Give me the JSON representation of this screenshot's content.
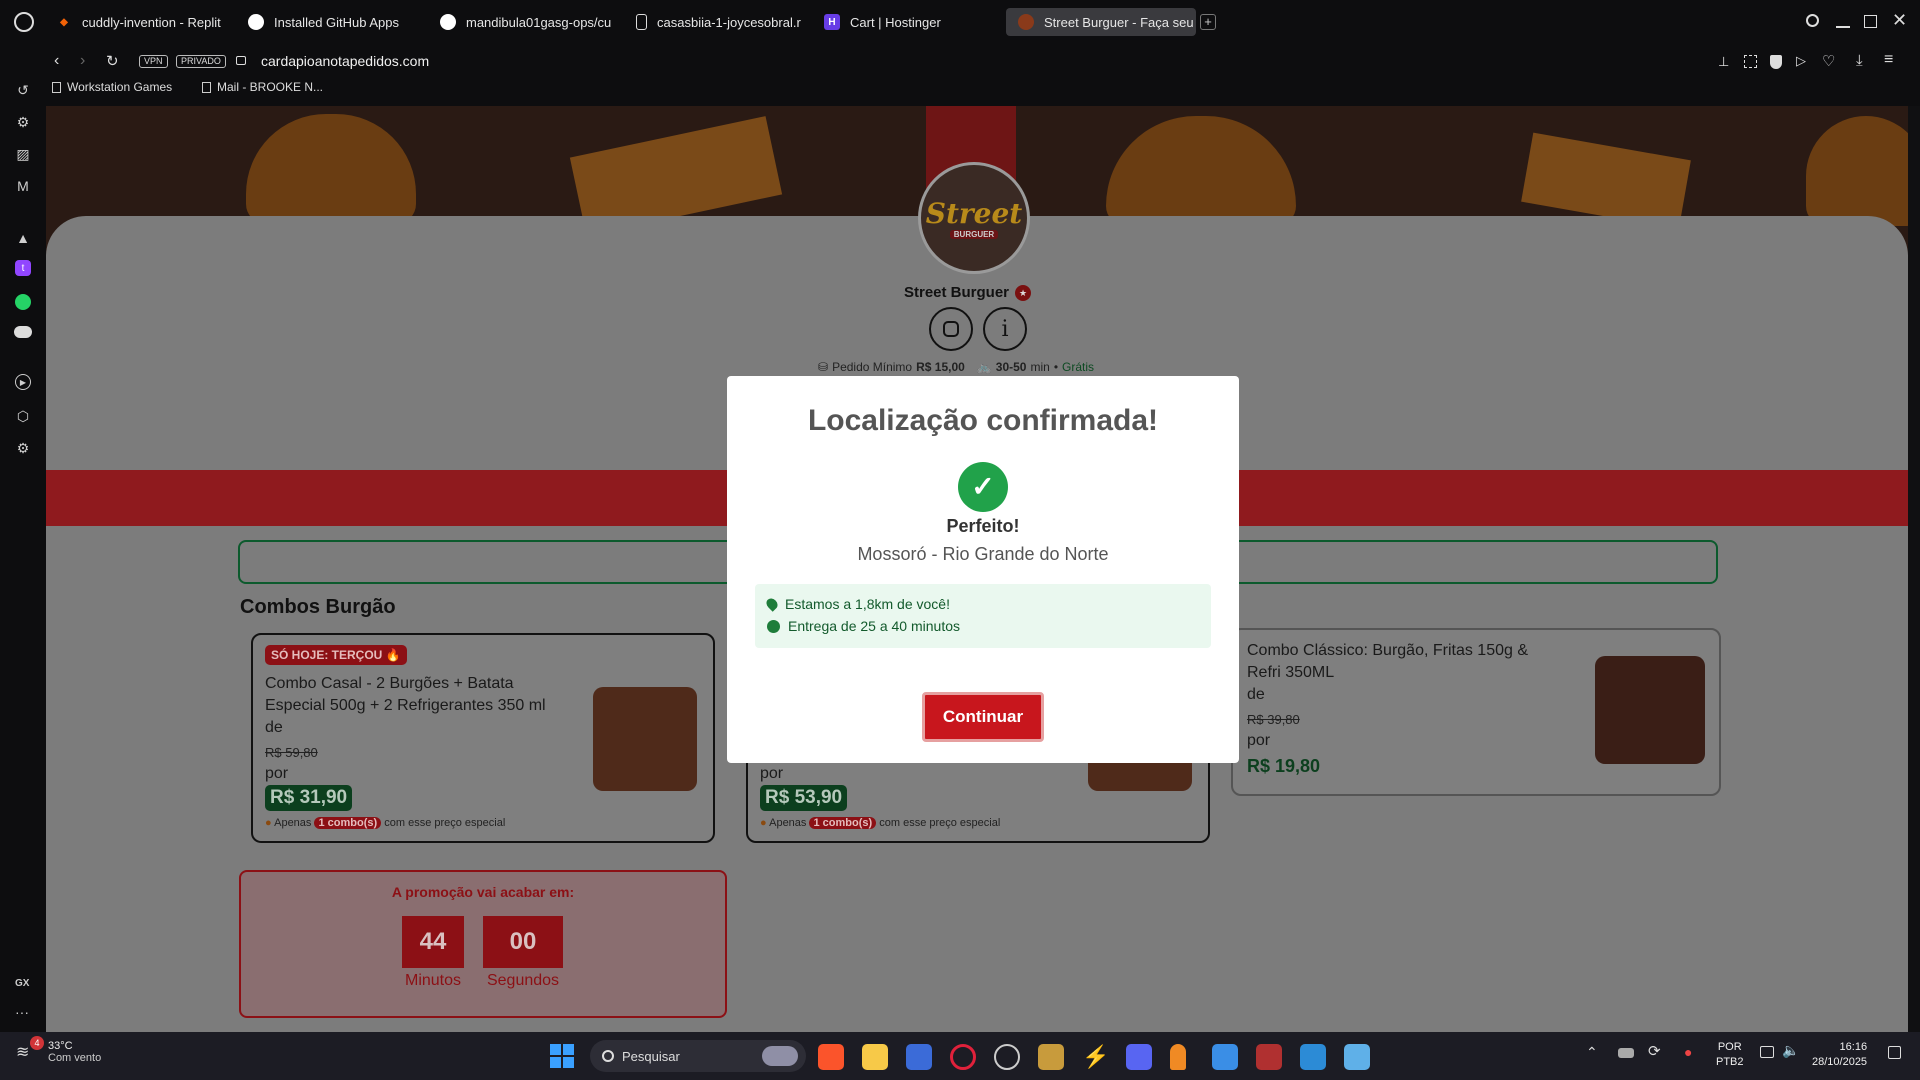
{
  "tabs": [
    {
      "label": "cuddly-invention - Replit",
      "icon": "replit-icon",
      "color": "#f26207"
    },
    {
      "label": "Installed GitHub Apps",
      "icon": "github-icon",
      "color": "#ffffff"
    },
    {
      "label": "mandibula01gasg-ops/cu",
      "icon": "github-icon",
      "color": "#ffffff"
    },
    {
      "label": "casasbiia-1-joycesobral.r",
      "icon": "file-icon",
      "color": "#dddddd"
    },
    {
      "label": "Cart | Hostinger",
      "icon": "hostinger-icon",
      "color": "#673de6"
    },
    {
      "label": "Street Burguer - Faça seu",
      "icon": "burger-icon",
      "color": "#c0392b"
    }
  ],
  "address": {
    "vpn": "VPN",
    "private": "PRIVADO",
    "url": "cardapioanotapedidos.com"
  },
  "bookmarks": [
    "Workstation Games",
    "Mail - BROOKE N..."
  ],
  "store": {
    "logo_text": "Street",
    "logo_sub": "BURGUER",
    "name": "Street Burguer",
    "min_order_label": "Pedido Mínimo",
    "min_order_value": "R$ 15,00",
    "delivery_time": "30-50",
    "time_unit": "min",
    "delivery_fee": "Grátis"
  },
  "section_title": "Combos Burgão",
  "products": [
    {
      "badge": "SÓ HOJE: TERÇOU",
      "name_line1": "Combo Casal - 2 Burgões + Batata",
      "name_line2": "Especial 500g + 2 Refrigerantes 350 ml",
      "de": "de",
      "old_price": "R$ 59,80",
      "por": "por",
      "price": "R$ 31,90",
      "note_pre": "Apenas",
      "note_count": "1 combo(s)",
      "note_post": "com esse preço especial"
    },
    {
      "por": "por",
      "price": "R$ 53,90",
      "note_pre": "Apenas",
      "note_count": "1 combo(s)",
      "note_post": "com esse preço especial"
    },
    {
      "name_line1": "Combo Clássico: Burgão, Fritas 150g &",
      "name_line2": "Refri 350ML",
      "de": "de",
      "old_price": "R$ 39,80",
      "por": "por",
      "price": "R$ 19,80"
    }
  ],
  "promo": {
    "title": "A promoção vai acabar em:",
    "minutes": "44",
    "seconds": "00",
    "minutes_label": "Minutos",
    "seconds_label": "Segundos"
  },
  "modal": {
    "title": "Localização confirmada!",
    "subtitle": "Perfeito!",
    "location": "Mossoró - Rio Grande do Norte",
    "info1": "Estamos a 1,8km de você!",
    "info2": "Entrega de 25 a 40 minutos",
    "button": "Continuar"
  },
  "taskbar": {
    "temp": "33°C",
    "weather": "Com vento",
    "weather_badge": "4",
    "search": "Pesquisar",
    "lang1": "POR",
    "lang2": "PTB2",
    "time": "16:16",
    "date": "28/10/2025"
  },
  "sidebar_label": "GX",
  "colors": {
    "accent_red": "#c8161d",
    "green": "#1e7d3a",
    "modal_check": "#21a24a"
  }
}
